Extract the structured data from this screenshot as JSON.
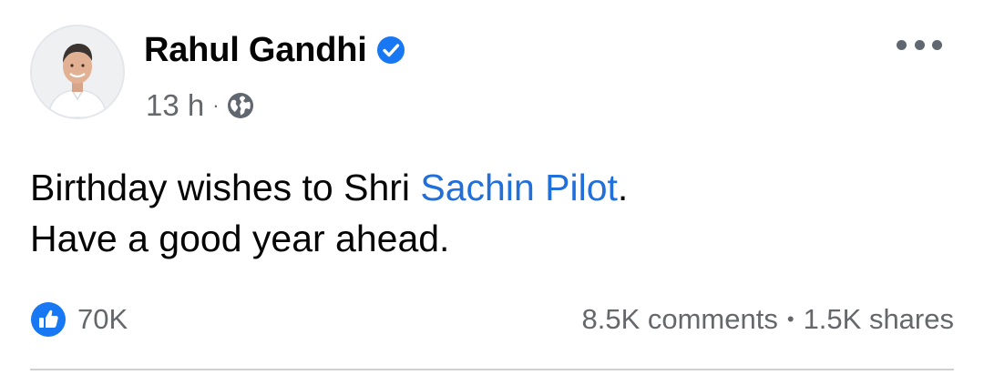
{
  "post": {
    "author": {
      "name": "Rahul Gandhi",
      "verified": true,
      "avatar": "profile-photo"
    },
    "meta": {
      "time": "13 h",
      "separator": "·",
      "audience_icon": "globe-icon"
    },
    "menu_icon": "more-options-icon",
    "text": {
      "line1_prefix": "Birthday wishes to Shri ",
      "mention": "Sachin Pilot",
      "line1_suffix": ".",
      "line2": "Have a good year ahead."
    },
    "reactions": {
      "icon": "like-icon",
      "count": "70K"
    },
    "stats": {
      "comments": "8.5K comments",
      "separator": "•",
      "shares": "1.5K shares"
    }
  },
  "colors": {
    "link": "#216fdb",
    "secondary_text": "#65676b",
    "like_badge": "#1877f2",
    "verified_badge": "#1877f2",
    "divider": "#ced0d4"
  }
}
